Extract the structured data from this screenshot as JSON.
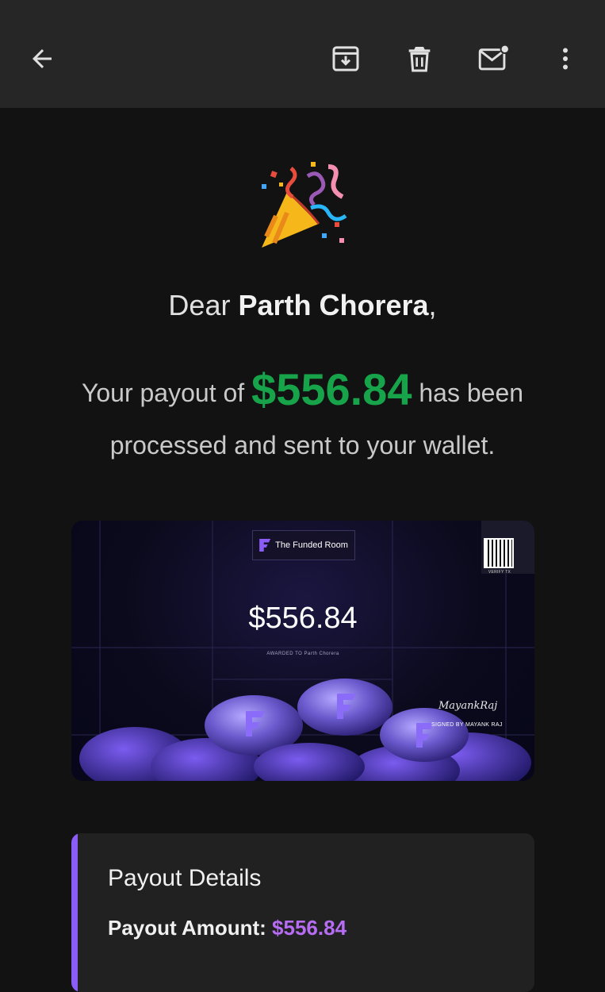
{
  "toolbar": {
    "back_icon": "arrow-back-icon",
    "archive_icon": "archive-download-icon",
    "delete_icon": "trash-icon",
    "mark_unread_icon": "mail-unread-icon",
    "more_icon": "more-vert-icon"
  },
  "email": {
    "decoration_icon": "party-popper-icon",
    "greeting_prefix": "Dear",
    "recipient_name": "Parth Chorera",
    "greeting_suffix": ",",
    "payout_prefix": "Your payout of",
    "payout_amount": "$556.84",
    "payout_suffix": "has been processed and sent to your wallet.",
    "accent_color": "#16a34a"
  },
  "certificate": {
    "brand": "The Funded Room",
    "qr_label": "VERIFY TX",
    "amount": "$556.84",
    "awarded_to": "AWARDED TO Parth Chorera",
    "signature": "MayankRaj",
    "signed_by": "SIGNED BY MAYANK RAJ"
  },
  "details": {
    "title": "Payout Details",
    "amount_label": "Payout Amount:",
    "amount_value": "$556.84",
    "accent_color": "#8b5cf6"
  }
}
